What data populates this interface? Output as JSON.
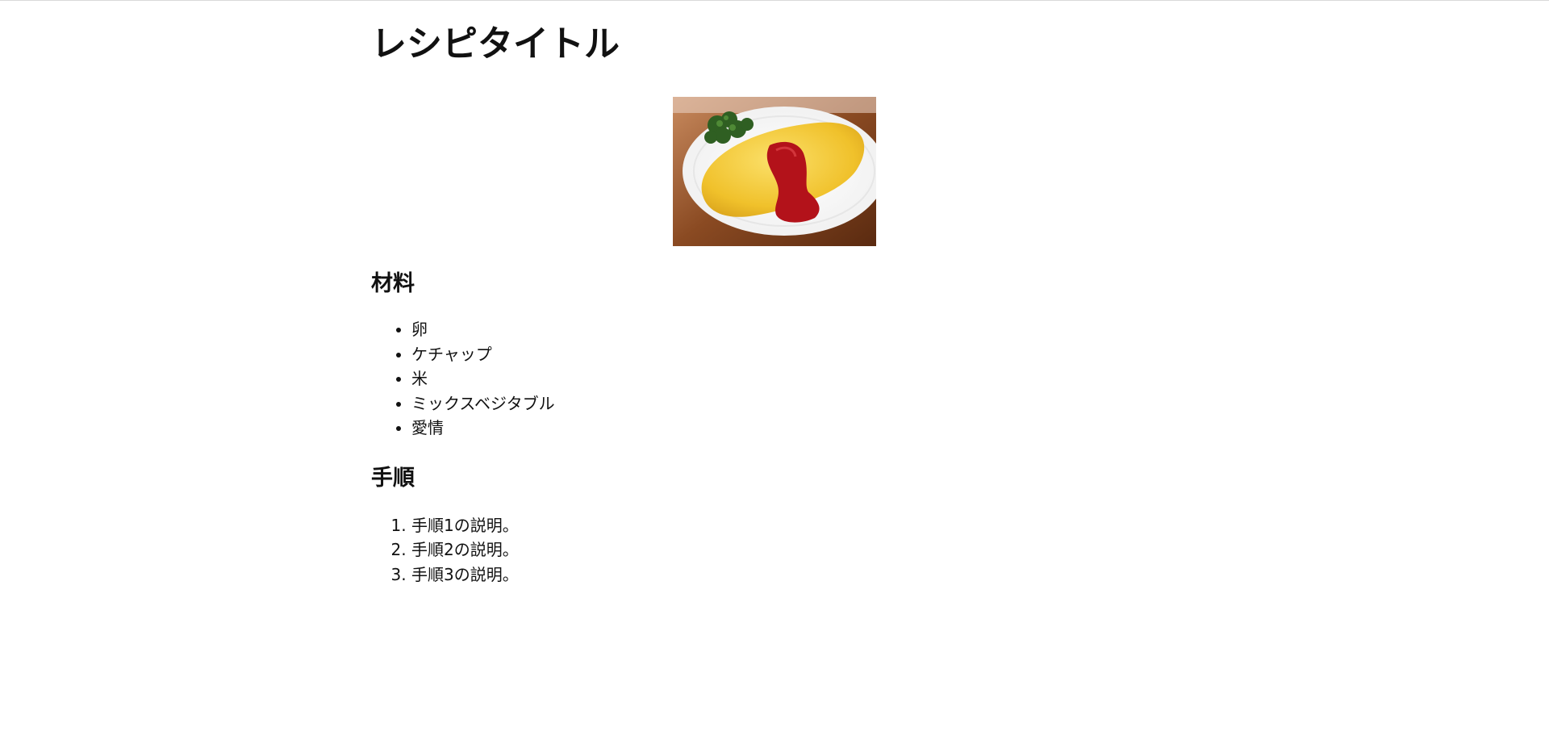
{
  "recipe": {
    "title": "レシピタイトル",
    "image_alt": "omelette-rice-photo",
    "ingredients_heading": "材料",
    "ingredients": [
      "卵",
      "ケチャップ",
      "米",
      "ミックスベジタブル",
      "愛情"
    ],
    "steps_heading": "手順",
    "steps": [
      "手順1の説明。",
      "手順2の説明。",
      "手順3の説明。"
    ]
  },
  "colors": {
    "text": "#111111",
    "egg": "#f2c12e",
    "ketchup": "#b3121a",
    "plate": "#f7f7f7",
    "table": "#7a3b17",
    "parsley": "#2f5f22"
  }
}
